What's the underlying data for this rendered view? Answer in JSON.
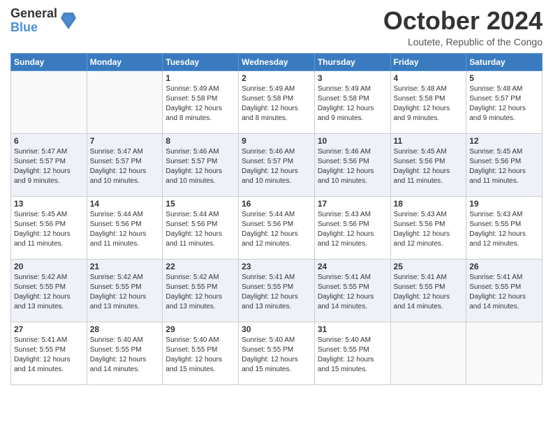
{
  "logo": {
    "general": "General",
    "blue": "Blue"
  },
  "title": {
    "month": "October 2024",
    "location": "Loutete, Republic of the Congo"
  },
  "headers": [
    "Sunday",
    "Monday",
    "Tuesday",
    "Wednesday",
    "Thursday",
    "Friday",
    "Saturday"
  ],
  "weeks": [
    [
      {
        "day": "",
        "info": ""
      },
      {
        "day": "",
        "info": ""
      },
      {
        "day": "1",
        "info": "Sunrise: 5:49 AM\nSunset: 5:58 PM\nDaylight: 12 hours and 8 minutes."
      },
      {
        "day": "2",
        "info": "Sunrise: 5:49 AM\nSunset: 5:58 PM\nDaylight: 12 hours and 8 minutes."
      },
      {
        "day": "3",
        "info": "Sunrise: 5:49 AM\nSunset: 5:58 PM\nDaylight: 12 hours and 9 minutes."
      },
      {
        "day": "4",
        "info": "Sunrise: 5:48 AM\nSunset: 5:58 PM\nDaylight: 12 hours and 9 minutes."
      },
      {
        "day": "5",
        "info": "Sunrise: 5:48 AM\nSunset: 5:57 PM\nDaylight: 12 hours and 9 minutes."
      }
    ],
    [
      {
        "day": "6",
        "info": "Sunrise: 5:47 AM\nSunset: 5:57 PM\nDaylight: 12 hours and 9 minutes."
      },
      {
        "day": "7",
        "info": "Sunrise: 5:47 AM\nSunset: 5:57 PM\nDaylight: 12 hours and 10 minutes."
      },
      {
        "day": "8",
        "info": "Sunrise: 5:46 AM\nSunset: 5:57 PM\nDaylight: 12 hours and 10 minutes."
      },
      {
        "day": "9",
        "info": "Sunrise: 5:46 AM\nSunset: 5:57 PM\nDaylight: 12 hours and 10 minutes."
      },
      {
        "day": "10",
        "info": "Sunrise: 5:46 AM\nSunset: 5:56 PM\nDaylight: 12 hours and 10 minutes."
      },
      {
        "day": "11",
        "info": "Sunrise: 5:45 AM\nSunset: 5:56 PM\nDaylight: 12 hours and 11 minutes."
      },
      {
        "day": "12",
        "info": "Sunrise: 5:45 AM\nSunset: 5:56 PM\nDaylight: 12 hours and 11 minutes."
      }
    ],
    [
      {
        "day": "13",
        "info": "Sunrise: 5:45 AM\nSunset: 5:56 PM\nDaylight: 12 hours and 11 minutes."
      },
      {
        "day": "14",
        "info": "Sunrise: 5:44 AM\nSunset: 5:56 PM\nDaylight: 12 hours and 11 minutes."
      },
      {
        "day": "15",
        "info": "Sunrise: 5:44 AM\nSunset: 5:56 PM\nDaylight: 12 hours and 11 minutes."
      },
      {
        "day": "16",
        "info": "Sunrise: 5:44 AM\nSunset: 5:56 PM\nDaylight: 12 hours and 12 minutes."
      },
      {
        "day": "17",
        "info": "Sunrise: 5:43 AM\nSunset: 5:56 PM\nDaylight: 12 hours and 12 minutes."
      },
      {
        "day": "18",
        "info": "Sunrise: 5:43 AM\nSunset: 5:56 PM\nDaylight: 12 hours and 12 minutes."
      },
      {
        "day": "19",
        "info": "Sunrise: 5:43 AM\nSunset: 5:55 PM\nDaylight: 12 hours and 12 minutes."
      }
    ],
    [
      {
        "day": "20",
        "info": "Sunrise: 5:42 AM\nSunset: 5:55 PM\nDaylight: 12 hours and 13 minutes."
      },
      {
        "day": "21",
        "info": "Sunrise: 5:42 AM\nSunset: 5:55 PM\nDaylight: 12 hours and 13 minutes."
      },
      {
        "day": "22",
        "info": "Sunrise: 5:42 AM\nSunset: 5:55 PM\nDaylight: 12 hours and 13 minutes."
      },
      {
        "day": "23",
        "info": "Sunrise: 5:41 AM\nSunset: 5:55 PM\nDaylight: 12 hours and 13 minutes."
      },
      {
        "day": "24",
        "info": "Sunrise: 5:41 AM\nSunset: 5:55 PM\nDaylight: 12 hours and 14 minutes."
      },
      {
        "day": "25",
        "info": "Sunrise: 5:41 AM\nSunset: 5:55 PM\nDaylight: 12 hours and 14 minutes."
      },
      {
        "day": "26",
        "info": "Sunrise: 5:41 AM\nSunset: 5:55 PM\nDaylight: 12 hours and 14 minutes."
      }
    ],
    [
      {
        "day": "27",
        "info": "Sunrise: 5:41 AM\nSunset: 5:55 PM\nDaylight: 12 hours and 14 minutes."
      },
      {
        "day": "28",
        "info": "Sunrise: 5:40 AM\nSunset: 5:55 PM\nDaylight: 12 hours and 14 minutes."
      },
      {
        "day": "29",
        "info": "Sunrise: 5:40 AM\nSunset: 5:55 PM\nDaylight: 12 hours and 15 minutes."
      },
      {
        "day": "30",
        "info": "Sunrise: 5:40 AM\nSunset: 5:55 PM\nDaylight: 12 hours and 15 minutes."
      },
      {
        "day": "31",
        "info": "Sunrise: 5:40 AM\nSunset: 5:55 PM\nDaylight: 12 hours and 15 minutes."
      },
      {
        "day": "",
        "info": ""
      },
      {
        "day": "",
        "info": ""
      }
    ]
  ]
}
